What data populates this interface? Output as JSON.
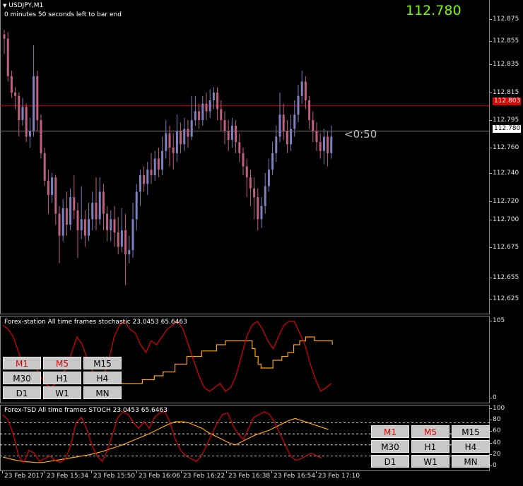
{
  "main": {
    "symbol": "USDJPY,M1",
    "bar_timer_text": "0 minutes 50 seconds left to bar end",
    "big_price": "112.780",
    "countdown": "<0:50",
    "price_ticks": [
      "112.875",
      "112.855",
      "112.835",
      "112.815",
      "112.795",
      "112.780",
      "112.760",
      "112.740",
      "112.720",
      "112.700",
      "112.675",
      "112.655",
      "112.625"
    ],
    "red_line_tag": "112.803",
    "current_price_tag": "112.780",
    "colors": {
      "up_candle": "#8080c0",
      "down_candle": "#c06080",
      "red_line": "#e00000",
      "price_line": "#808080",
      "big_price": "#7cfc00"
    }
  },
  "ind1": {
    "title": "Forex-station All time frames stochastic 23.0453 65.6463",
    "scale_top": "105",
    "scale_bottom": "0",
    "timeframes": [
      {
        "label": "M1",
        "active": true
      },
      {
        "label": "M5",
        "active": true
      },
      {
        "label": "M15",
        "active": false
      },
      {
        "label": "M30",
        "active": false
      },
      {
        "label": "H1",
        "active": false
      },
      {
        "label": "H4",
        "active": false
      },
      {
        "label": "D1",
        "active": false
      },
      {
        "label": "W1",
        "active": false
      },
      {
        "label": "MN",
        "active": false
      }
    ]
  },
  "ind2": {
    "title": "Forex-TSD All time frames STOCH 23.0453 65.6463",
    "scale_ticks": [
      "100",
      "80",
      "60",
      "40",
      "20",
      "0"
    ],
    "timeframes": [
      {
        "label": "M1",
        "active": true
      },
      {
        "label": "M5",
        "active": true
      },
      {
        "label": "M15",
        "active": false
      },
      {
        "label": "M30",
        "active": false
      },
      {
        "label": "H1",
        "active": false
      },
      {
        "label": "H4",
        "active": false
      },
      {
        "label": "D1",
        "active": false
      },
      {
        "label": "W1",
        "active": false
      },
      {
        "label": "MN",
        "active": false
      }
    ]
  },
  "time_axis": [
    "23 Feb 2017",
    "23 Feb 15:34",
    "23 Feb 15:50",
    "23 Feb 16:06",
    "23 Feb 16:22",
    "23 Feb 16:38",
    "23 Feb 16:54",
    "23 Feb 17:10"
  ],
  "chart_data": {
    "type": "candlestick",
    "candles": [
      [
        112.868,
        112.864,
        112.872,
        112.85
      ],
      [
        112.864,
        112.83,
        112.87,
        112.825
      ],
      [
        112.83,
        112.815,
        112.835,
        112.81
      ],
      [
        112.815,
        112.812,
        112.82,
        112.8
      ],
      [
        112.812,
        112.79,
        112.815,
        112.775
      ],
      [
        112.79,
        112.802,
        112.81,
        112.785
      ],
      [
        112.802,
        112.775,
        112.805,
        112.77
      ],
      [
        112.775,
        112.78,
        112.792,
        112.765
      ],
      [
        112.78,
        112.83,
        112.858,
        112.775
      ],
      [
        112.83,
        112.79,
        112.835,
        112.78
      ],
      [
        112.79,
        112.76,
        112.795,
        112.755
      ],
      [
        112.76,
        112.735,
        112.765,
        112.73
      ],
      [
        112.735,
        112.722,
        112.745,
        112.705
      ],
      [
        112.722,
        112.738,
        112.742,
        112.715
      ],
      [
        112.738,
        112.705,
        112.74,
        112.695
      ],
      [
        112.705,
        112.685,
        112.712,
        112.66
      ],
      [
        112.685,
        112.71,
        112.718,
        112.68
      ],
      [
        112.71,
        112.695,
        112.725,
        112.685
      ],
      [
        112.695,
        112.72,
        112.728,
        112.69
      ],
      [
        112.72,
        112.708,
        112.74,
        112.7
      ],
      [
        112.708,
        112.69,
        112.715,
        112.665
      ],
      [
        112.69,
        112.7,
        112.73,
        112.682
      ],
      [
        112.7,
        112.685,
        112.708,
        112.675
      ],
      [
        112.685,
        112.7,
        112.715,
        112.68
      ],
      [
        112.7,
        112.715,
        112.725,
        112.69
      ],
      [
        112.715,
        112.7,
        112.738,
        112.69
      ],
      [
        112.7,
        112.725,
        112.738,
        112.695
      ],
      [
        112.725,
        112.705,
        112.732,
        112.69
      ],
      [
        112.705,
        112.69,
        112.712,
        112.68
      ],
      [
        112.69,
        112.7,
        112.708,
        112.68
      ],
      [
        112.7,
        112.688,
        112.712,
        112.675
      ],
      [
        112.688,
        112.675,
        112.702,
        112.668
      ],
      [
        112.675,
        112.69,
        112.71,
        112.67
      ],
      [
        112.69,
        112.668,
        112.705,
        112.64
      ],
      [
        112.668,
        112.672,
        112.685,
        112.66
      ],
      [
        112.672,
        112.7,
        112.715,
        112.665
      ],
      [
        112.7,
        112.725,
        112.732,
        112.69
      ],
      [
        112.725,
        112.74,
        112.745,
        112.712
      ],
      [
        112.74,
        112.732,
        112.748,
        112.725
      ],
      [
        112.732,
        112.745,
        112.752,
        112.722
      ],
      [
        112.745,
        112.74,
        112.76,
        112.732
      ],
      [
        112.74,
        112.755,
        112.762,
        112.735
      ],
      [
        112.755,
        112.745,
        112.765,
        112.738
      ],
      [
        112.745,
        112.762,
        112.775,
        112.74
      ],
      [
        112.762,
        112.778,
        112.79,
        112.755
      ],
      [
        112.778,
        112.765,
        112.785,
        112.748
      ],
      [
        112.765,
        112.76,
        112.778,
        112.745
      ],
      [
        112.76,
        112.78,
        112.795,
        112.752
      ],
      [
        112.78,
        112.768,
        112.788,
        112.76
      ],
      [
        112.768,
        112.782,
        112.792,
        112.762
      ],
      [
        112.782,
        112.775,
        112.79,
        112.765
      ],
      [
        112.775,
        112.79,
        112.812,
        112.772
      ],
      [
        112.79,
        112.798,
        112.812,
        112.785
      ],
      [
        112.798,
        112.79,
        112.805,
        112.782
      ],
      [
        112.79,
        112.805,
        112.812,
        112.785
      ],
      [
        112.805,
        112.798,
        112.815,
        112.79
      ],
      [
        112.798,
        112.808,
        112.818,
        112.792
      ],
      [
        112.808,
        112.815,
        112.82,
        112.8
      ],
      [
        112.815,
        112.8,
        112.82,
        112.79
      ],
      [
        112.8,
        112.79,
        112.808,
        112.78
      ],
      [
        112.79,
        112.78,
        112.798,
        112.768
      ],
      [
        112.78,
        112.772,
        112.79,
        112.762
      ],
      [
        112.772,
        112.785,
        112.792,
        112.765
      ],
      [
        112.785,
        112.77,
        112.79,
        112.76
      ],
      [
        112.77,
        112.76,
        112.778,
        112.752
      ],
      [
        112.76,
        112.748,
        112.765,
        112.74
      ],
      [
        112.748,
        112.738,
        112.755,
        112.72
      ],
      [
        112.738,
        112.728,
        112.745,
        112.712
      ],
      [
        112.728,
        112.72,
        112.738,
        112.7
      ],
      [
        112.72,
        112.7,
        112.728,
        112.69
      ],
      [
        112.7,
        112.712,
        112.72,
        112.692
      ],
      [
        112.712,
        112.73,
        112.742,
        112.705
      ],
      [
        112.73,
        112.745,
        112.755,
        112.725
      ],
      [
        112.745,
        112.76,
        112.77,
        112.74
      ],
      [
        112.76,
        112.775,
        112.785,
        112.752
      ],
      [
        112.775,
        112.795,
        112.815,
        112.77
      ],
      [
        112.795,
        112.78,
        112.805,
        112.772
      ],
      [
        112.78,
        112.768,
        112.79,
        112.76
      ],
      [
        112.768,
        112.782,
        112.795,
        112.762
      ],
      [
        112.782,
        112.795,
        112.808,
        112.775
      ],
      [
        112.795,
        112.812,
        112.822,
        112.788
      ],
      [
        112.812,
        112.825,
        112.835,
        112.805
      ],
      [
        112.825,
        112.808,
        112.83,
        112.8
      ],
      [
        112.808,
        112.79,
        112.812,
        112.782
      ],
      [
        112.79,
        112.78,
        112.798,
        112.77
      ],
      [
        112.78,
        112.77,
        112.788,
        112.762
      ],
      [
        112.77,
        112.762,
        112.778,
        112.755
      ],
      [
        112.762,
        112.775,
        112.782,
        112.75
      ],
      [
        112.775,
        112.76,
        112.78,
        112.748
      ],
      [
        112.76,
        112.775,
        112.785,
        112.755
      ]
    ],
    "red_line": 112.803,
    "price_line": 112.78,
    "ylim": [
      112.62,
      112.885
    ],
    "ind1_orange": [
      20,
      20,
      20,
      20,
      20,
      20,
      20,
      25,
      25,
      25,
      25,
      30,
      30,
      30,
      35,
      35,
      35,
      35,
      45,
      45,
      45,
      45,
      55,
      55,
      55,
      55,
      55,
      62,
      62,
      62,
      62,
      62,
      70,
      70,
      70,
      75,
      75,
      75,
      75,
      75,
      75,
      75,
      75,
      75,
      65,
      55,
      45,
      40,
      40,
      40,
      40,
      50,
      50,
      50,
      55,
      55,
      60,
      60,
      70,
      70,
      75,
      75,
      80,
      80,
      80,
      75,
      75,
      75,
      75,
      75,
      75,
      70
    ],
    "ind1_red": [
      95,
      90,
      80,
      60,
      40,
      50,
      45,
      30,
      20,
      15,
      20,
      30,
      40,
      60,
      80,
      70,
      50,
      35,
      20,
      30,
      50,
      80,
      95,
      100,
      90,
      85,
      70,
      60,
      75,
      70,
      80,
      90,
      95,
      100,
      90,
      70,
      50,
      30,
      15,
      10,
      15,
      20,
      10,
      15,
      30,
      55,
      80,
      95,
      100,
      90,
      75,
      65,
      80,
      95,
      100,
      100,
      85,
      70,
      45,
      25,
      10,
      15,
      20
    ]
  }
}
